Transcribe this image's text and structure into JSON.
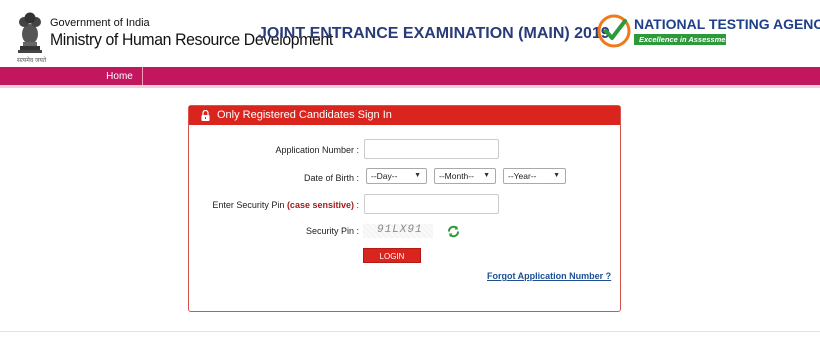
{
  "header": {
    "gov_line1": "Government of India",
    "gov_line2": "Ministry of Human Resource Development",
    "gov_line3": "सत्यमेव जयते",
    "exam_title": "JOINT ENTRANCE EXAMINATION (MAIN) 2019",
    "agency_name": "NATIONAL TESTING AGENCY",
    "agency_tagline": "Excellence in Assessment"
  },
  "nav": {
    "home_label": "Home"
  },
  "panel": {
    "title": "Only Registered Candidates Sign In",
    "application_number_label": "Application Number :",
    "application_number_value": "",
    "dob_label": "Date of Birth :",
    "day_value": "--Day--",
    "month_value": "--Month--",
    "year_value": "--Year--",
    "security_pin_label_prefix": "Enter Security Pin ",
    "security_pin_label_accent": "(case sensitive)",
    "security_pin_label_suffix": " :",
    "security_pin_value": "",
    "captcha_label": "Security Pin :",
    "captcha_text": "91LX91",
    "login_label": "LOGIN",
    "forgot_label": "Forgot Application Number ?"
  },
  "colors": {
    "nav_bg": "#c2175f",
    "panel_header": "#d9251d",
    "title_blue": "#283c7a",
    "nta_green": "#2c9a3a"
  },
  "icons": {
    "emblem": "emblem-icon",
    "nta_logo": "nta-check-icon",
    "lock": "lock-icon",
    "refresh": "refresh-icon"
  }
}
